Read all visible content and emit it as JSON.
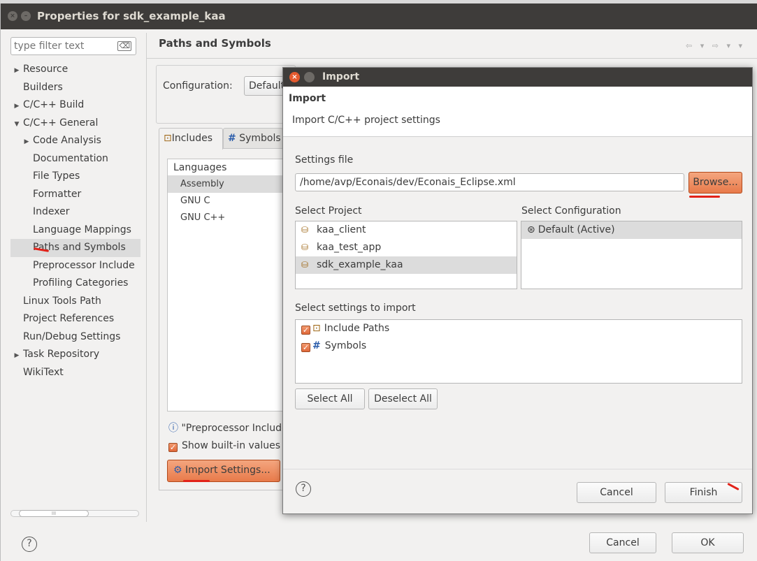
{
  "window": {
    "title": "Properties for sdk_example_kaa",
    "close_glyph": "×",
    "min_glyph": "–"
  },
  "left": {
    "filter_placeholder": "type filter text",
    "filter_clear_glyph": "⌫",
    "tree": [
      {
        "label": "Resource",
        "indent": 0,
        "twisty": "▶"
      },
      {
        "label": "Builders",
        "indent": 0,
        "twisty": ""
      },
      {
        "label": "C/C++ Build",
        "indent": 0,
        "twisty": "▶"
      },
      {
        "label": "C/C++ General",
        "indent": 0,
        "twisty": "▼"
      },
      {
        "label": "Code Analysis",
        "indent": 1,
        "twisty": "▶"
      },
      {
        "label": "Documentation",
        "indent": 1,
        "twisty": ""
      },
      {
        "label": "File Types",
        "indent": 1,
        "twisty": ""
      },
      {
        "label": "Formatter",
        "indent": 1,
        "twisty": ""
      },
      {
        "label": "Indexer",
        "indent": 1,
        "twisty": ""
      },
      {
        "label": "Language Mappings",
        "indent": 1,
        "twisty": ""
      },
      {
        "label": "Paths and Symbols",
        "indent": 1,
        "twisty": "",
        "selected": true
      },
      {
        "label": "Preprocessor Include",
        "indent": 1,
        "twisty": ""
      },
      {
        "label": "Profiling Categories",
        "indent": 1,
        "twisty": ""
      },
      {
        "label": "Linux Tools Path",
        "indent": 0,
        "twisty": ""
      },
      {
        "label": "Project References",
        "indent": 0,
        "twisty": ""
      },
      {
        "label": "Run/Debug Settings",
        "indent": 0,
        "twisty": ""
      },
      {
        "label": "Task Repository",
        "indent": 0,
        "twisty": "▶"
      },
      {
        "label": "WikiText",
        "indent": 0,
        "twisty": ""
      }
    ],
    "scroll_thumb_text": "III"
  },
  "right": {
    "page_title": "Paths and Symbols",
    "nav_arrows": "⇦ ▾ ⇨ ▾ ▾",
    "configuration_label": "Configuration:",
    "configuration_value": "Default",
    "tabs": [
      {
        "label": "Includes",
        "icon": "⊡"
      },
      {
        "label": "Symbols",
        "icon": "#"
      }
    ],
    "languages_header": "Languages",
    "languages": [
      "Assembly",
      "GNU C",
      "GNU C++"
    ],
    "info_icon": "ⓘ",
    "info_text": "\"Preprocessor Include Paths, Macros etc.\"",
    "show_builtin": "Show built-in values",
    "import_settings": "Import Settings...",
    "import_icon": "⚙"
  },
  "bottom": {
    "help": "?",
    "cancel": "Cancel",
    "ok": "OK"
  },
  "dialog": {
    "title": "Import",
    "header_title": "Import",
    "header_desc": "Import C/C++ project settings",
    "settings_file_label": "Settings file",
    "settings_file_value": "/home/avp/Econais/dev/Econais_Eclipse.xml",
    "browse": "Browse...",
    "select_project_label": "Select Project",
    "projects": [
      "kaa_client",
      "kaa_test_app",
      "sdk_example_kaa"
    ],
    "select_configuration_label": "Select Configuration",
    "configurations": [
      "Default (Active)"
    ],
    "config_icon": "⊛",
    "folder_icon": "⛁",
    "select_settings_label": "Select settings to import",
    "settings": [
      {
        "label": "Include Paths",
        "icon": "⊡",
        "checked": true
      },
      {
        "label": "Symbols",
        "icon": "#",
        "checked": true
      }
    ],
    "check_glyph": "✓",
    "select_all": "Select All",
    "deselect_all": "Deselect All",
    "help": "?",
    "cancel": "Cancel",
    "finish": "Finish"
  },
  "colors": {
    "accent": "#e87a4a",
    "annotation_red": "#e2231a",
    "titlebar": "#3e3c3a"
  }
}
